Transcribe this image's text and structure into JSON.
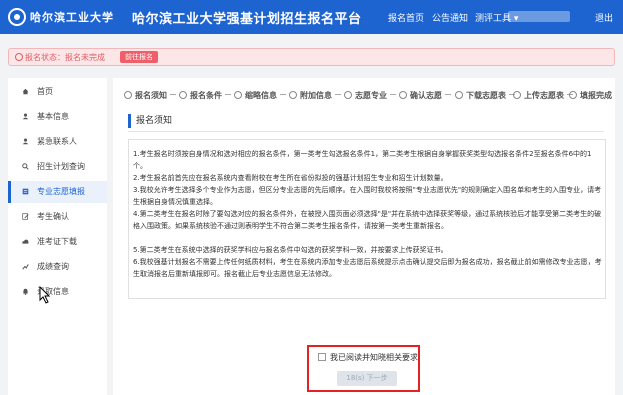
{
  "header": {
    "logo_text": "哈尔滨工业大学",
    "title": "哈尔滨工业大学强基计划招生报名平台",
    "nav": [
      "报名首页",
      "公告通知",
      "测评工具 ▾",
      "退出"
    ]
  },
  "alert": {
    "text": "报名状态：报名未完成",
    "button": "前往报名"
  },
  "sidebar": {
    "items": [
      {
        "label": "首页",
        "icon": "home-icon"
      },
      {
        "label": "基本信息",
        "icon": "user-icon"
      },
      {
        "label": "紧急联系人",
        "icon": "contact-icon"
      },
      {
        "label": "招生计划查询",
        "icon": "search-icon"
      },
      {
        "label": "专业志愿填报",
        "icon": "form-icon"
      },
      {
        "label": "考生确认",
        "icon": "edit-icon"
      },
      {
        "label": "准考证下载",
        "icon": "cloud-icon"
      },
      {
        "label": "成绩查询",
        "icon": "score-icon"
      },
      {
        "label": "录取信息",
        "icon": "bell-icon"
      }
    ],
    "active_index": 4
  },
  "steps": [
    "报名须知",
    "报名条件",
    "缩略信息",
    "附加信息",
    "志愿专业",
    "确认志愿",
    "下载志愿表",
    "上传志愿表",
    "填报完成"
  ],
  "section_title": "报名须知",
  "notice": [
    "1.考生报名时须按自身情况和选对相应的报名条件，第一类考生勾选报名条件1，第二类考生根据自身掌握获奖类型勾选报名条件2至报名条件6中的1个。",
    "2.考生报名前首先应在报名系统内查看附校在考生所在省份拟投的强基计划招生专业和招生计划数量。",
    "3.我校允许考生选择多个专业作为志愿，但区分专业志愿的先后顺序。在入围时我校将按照\"专业志愿优先\"的规则确定入围名单和考生的入围专业，请考生根据自身情况慎重选择。",
    "4.第二类考生在报名时除了要勾选对应的报名条件外，在被授入围页面必须选择\"是\"并在系统中选择获奖等级，通过系统核验后才能享受第二类考生的破格入围政策。如果系统核验不通过则表明学生不符合第二类考生报名条件，请按第一类考生重新报名。",
    "5.第二类考生在系统中选择的获奖学科应与报名条件中勾选的获奖学科一致，并按要求上传获奖证书。",
    "6.我校强基计划报名不需要上传任何纸质材料，考生在系统内添加专业志愿后系统提示点击确认提交后即为报名成功，报名截止前如需修改专业志愿，考生取消报名后重新填报即可。报名截止后专业志愿信息无法修改。"
  ],
  "agree_label": "我已阅读并知晓相关要求",
  "next_button": "18(s) 下一步"
}
